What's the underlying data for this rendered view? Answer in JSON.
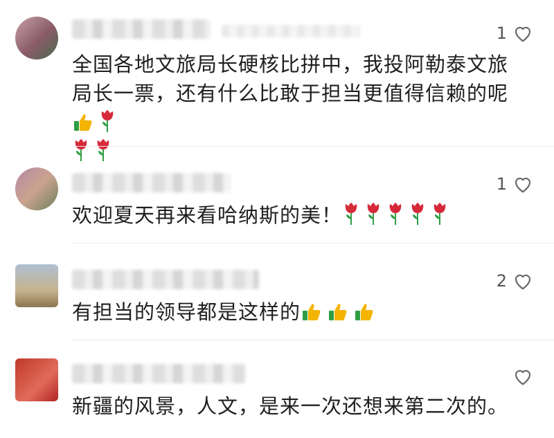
{
  "comments": [
    {
      "likes": "1",
      "text": "全国各地文旅局长硬核比拼中，我投阿勒泰文旅局长一票，还有什么比敢于担当更值得信赖的呢",
      "emoji": [
        "thumbs-up",
        "rose",
        "rose",
        "rose"
      ]
    },
    {
      "likes": "1",
      "text": "欢迎夏天再来看哈纳斯的美！",
      "emoji": [
        "rose",
        "rose",
        "rose",
        "rose",
        "rose"
      ]
    },
    {
      "likes": "2",
      "text": "有担当的领导都是这样的",
      "emoji": [
        "thumbs-up",
        "thumbs-up",
        "thumbs-up"
      ]
    },
    {
      "likes": "",
      "text": "新疆的风景，人文，是来一次还想来第二次的。",
      "emoji": []
    }
  ],
  "colors": {
    "rose": "#d62a3a",
    "stem": "#2f9e44",
    "thumb": "#f4b400",
    "heart_outline": "#6b6b6b"
  }
}
